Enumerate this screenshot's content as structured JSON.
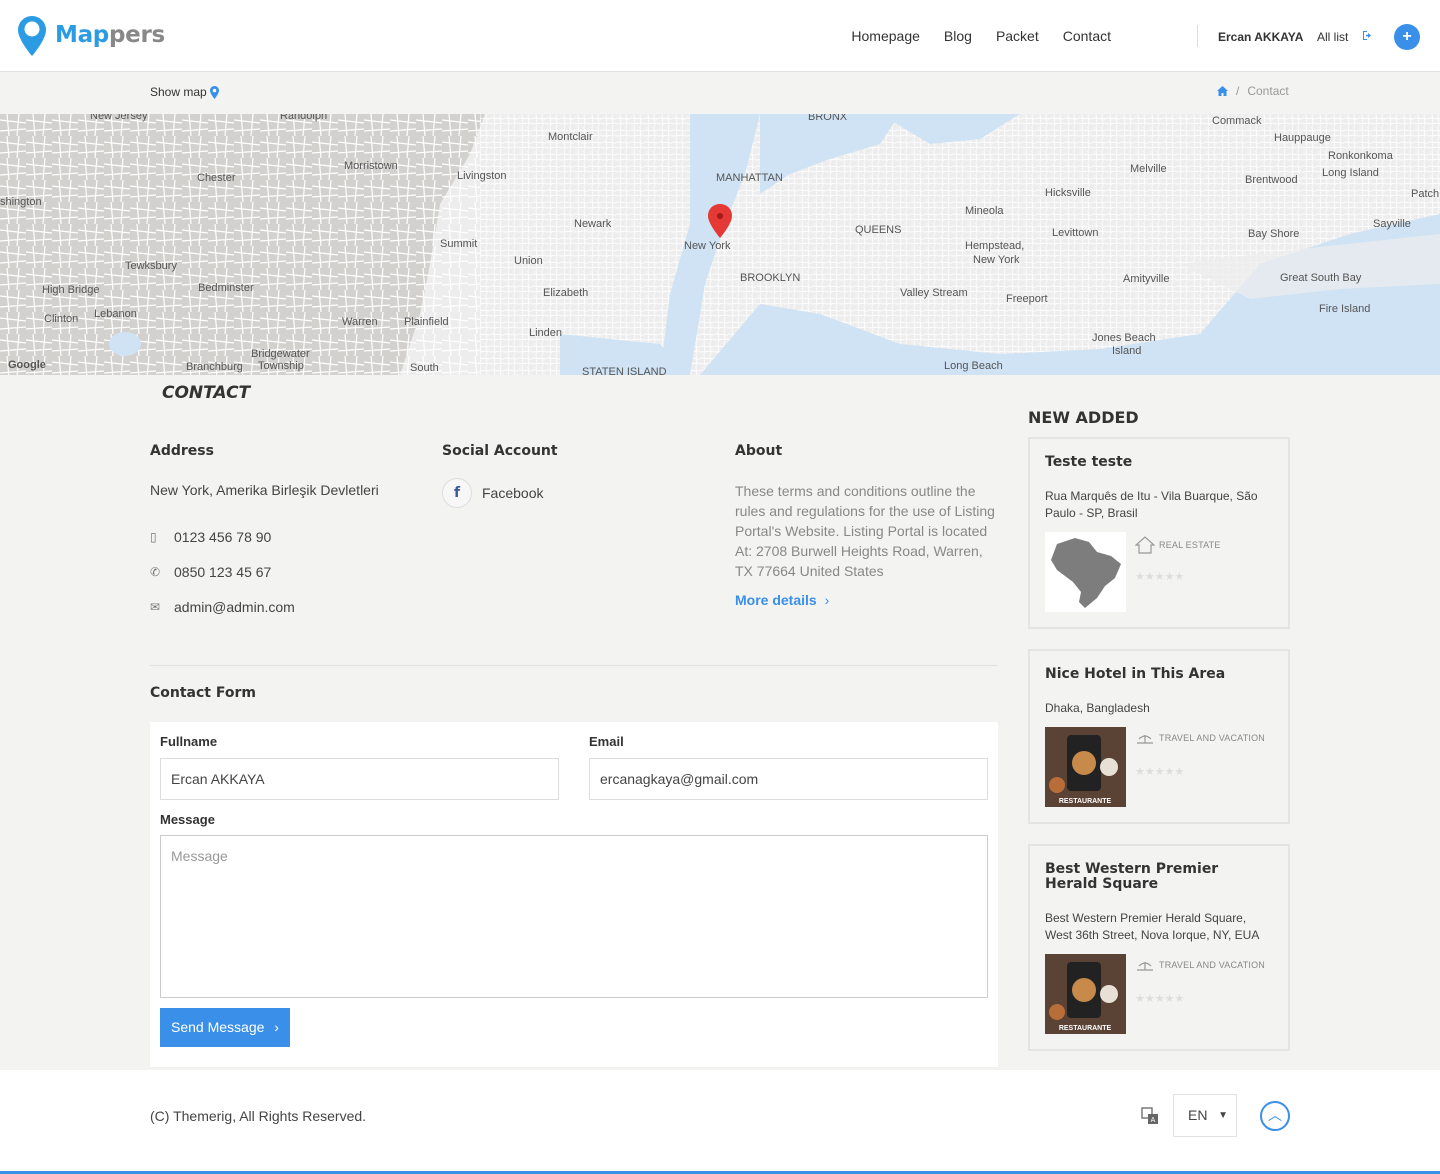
{
  "header": {
    "logo_part1": "Map",
    "logo_part2": "pers",
    "nav": [
      "Homepage",
      "Blog",
      "Packet",
      "Contact"
    ],
    "user_name": "Ercan AKKAYA",
    "all_list": "All list",
    "add_label": "+"
  },
  "subbar": {
    "show_map": "Show map",
    "breadcrumb_current": "Contact"
  },
  "map": {
    "labels": [
      "New Jersey",
      "Randolph",
      "BRONX",
      "Commack",
      "Montclair",
      "Hauppauge",
      "Ronkonkoma",
      "Long Island",
      "Morristown",
      "MANHATTAN",
      "Melville",
      "Chester",
      "Livingston",
      "Brentwood",
      "Patch",
      "shington",
      "Hicksville",
      "Mineola",
      "Newark",
      "New York",
      "QUEENS",
      "Sayville",
      "Levittown",
      "Bay Shore",
      "Hempstead,",
      "New York",
      "Summit",
      "Union",
      "Tewksbury",
      "BROOKLYN",
      "Amityville",
      "High Bridge",
      "Bedminster",
      "Elizabeth",
      "Valley Stream",
      "Freeport",
      "Great South Bay",
      "Fire Island",
      "Clinton",
      "Lebanon",
      "Warren",
      "Plainfield",
      "Linden",
      "Jones Beach",
      "Island",
      "Bridgewater",
      "Branchburg",
      "Township",
      "South",
      "STATEN ISLAND",
      "Long Beach",
      "Google"
    ]
  },
  "contact": {
    "title": "CONTACT",
    "address_heading": "Address",
    "address": "New York, Amerika Birleşik Devletleri",
    "phone1": "0123 456 78 90",
    "phone2": "0850 123 45 67",
    "email": "admin@admin.com",
    "social_heading": "Social Account",
    "facebook": "Facebook",
    "about_heading": "About",
    "about_text": "These terms and conditions outline the rules and regulations for the use of Listing Portal's Website. Listing Portal is located At: 2708 Burwell Heights Road, Warren, TX 77664 United States",
    "more_details": "More details"
  },
  "form": {
    "heading": "Contact Form",
    "fullname_label": "Fullname",
    "fullname_value": "Ercan AKKAYA",
    "email_label": "Email",
    "email_value": "ercanagkaya@gmail.com",
    "message_label": "Message",
    "message_placeholder": "Message",
    "send_label": "Send Message"
  },
  "sidebar": {
    "heading": "NEW ADDED",
    "cards": [
      {
        "title": "Teste teste",
        "address": "Rua Marquês de Itu - Vila Buarque, São Paulo - SP, Brasil",
        "category": "REAL ESTATE",
        "image": "brazil-map-icon",
        "rating": 0
      },
      {
        "title": "Nice Hotel in This Area",
        "address": "Dhaka, Bangladesh",
        "category": "TRAVEL AND VACATION",
        "image": "restaurant-photo",
        "image_text": "RESTAURANTE",
        "rating": 0
      },
      {
        "title": "Best Western Premier Herald Square",
        "address": "Best Western Premier Herald Square, West 36th Street, Nova Iorque, NY, EUA",
        "category": "TRAVEL AND VACATION",
        "image": "restaurant-photo",
        "image_text": "RESTAURANTE",
        "rating": 0
      }
    ]
  },
  "footer": {
    "copyright": "(C) Themerig, All Rights Reserved.",
    "language": "EN"
  },
  "colors": {
    "accent": "#3a8fe8",
    "logo": "#2b9be3",
    "map_water": "#cfe3f5",
    "pin": "#e53935"
  }
}
